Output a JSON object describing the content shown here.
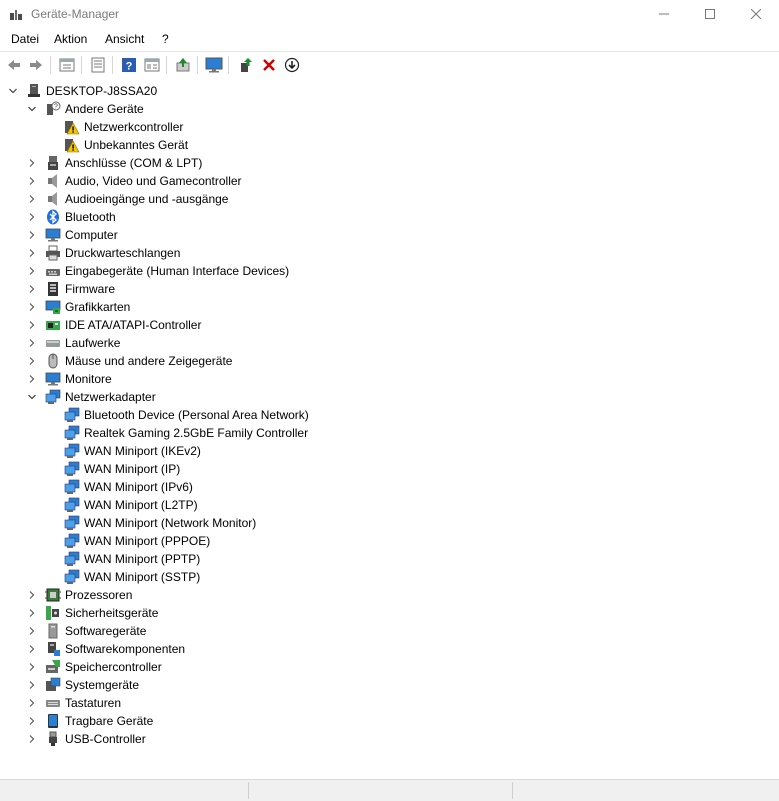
{
  "window": {
    "title": "Geräte-Manager"
  },
  "menu": [
    "Datei",
    "Aktion",
    "Ansicht",
    "?"
  ],
  "toolbar": {
    "colors": {
      "back": "#6e6e6e",
      "forward": "#6e6e6e",
      "help": "#2a5db0",
      "update": "#1a8a2a",
      "remove": "#d00000",
      "monitor": "#2b7fd3"
    },
    "buttons": [
      {
        "name": "back-button",
        "icon": "arrow-left-icon"
      },
      {
        "name": "forward-button",
        "icon": "arrow-right-icon"
      },
      {
        "name": "properties-button",
        "icon": "properties-icon"
      },
      {
        "name": "details-button",
        "icon": "details-icon"
      },
      {
        "name": "help-button",
        "icon": "help-icon"
      },
      {
        "name": "view-button",
        "icon": "view-icon"
      },
      {
        "name": "update-driver-button",
        "icon": "update-driver-icon"
      },
      {
        "name": "scan-hardware-button",
        "icon": "monitor-icon"
      },
      {
        "name": "enable-device-button",
        "icon": "enable-icon"
      },
      {
        "name": "uninstall-button",
        "icon": "red-x-icon"
      },
      {
        "name": "disable-button",
        "icon": "download-circle-icon"
      }
    ]
  },
  "tree": [
    {
      "label": "DESKTOP-J8SSA20",
      "level": 0,
      "expander": "expanded",
      "icon": "computer-root-icon"
    },
    {
      "label": "Andere Geräte",
      "level": 1,
      "expander": "expanded",
      "icon": "other-devices-icon"
    },
    {
      "label": "Netzwerkcontroller",
      "level": 2,
      "expander": "none",
      "icon": "warning-device-icon"
    },
    {
      "label": "Unbekanntes Gerät",
      "level": 2,
      "expander": "none",
      "icon": "warning-device-icon"
    },
    {
      "label": "Anschlüsse (COM & LPT)",
      "level": 1,
      "expander": "collapsed",
      "icon": "port-icon"
    },
    {
      "label": "Audio, Video und Gamecontroller",
      "level": 1,
      "expander": "collapsed",
      "icon": "speaker-icon"
    },
    {
      "label": "Audioeingänge und -ausgänge",
      "level": 1,
      "expander": "collapsed",
      "icon": "speaker-icon"
    },
    {
      "label": "Bluetooth",
      "level": 1,
      "expander": "collapsed",
      "icon": "bluetooth-icon"
    },
    {
      "label": "Computer",
      "level": 1,
      "expander": "collapsed",
      "icon": "monitor-icon"
    },
    {
      "label": "Druckwarteschlangen",
      "level": 1,
      "expander": "collapsed",
      "icon": "printer-icon"
    },
    {
      "label": "Eingabegeräte (Human Interface Devices)",
      "level": 1,
      "expander": "collapsed",
      "icon": "hid-icon"
    },
    {
      "label": "Firmware",
      "level": 1,
      "expander": "collapsed",
      "icon": "firmware-icon"
    },
    {
      "label": "Grafikkarten",
      "level": 1,
      "expander": "collapsed",
      "icon": "display-adapter-icon"
    },
    {
      "label": "IDE ATA/ATAPI-Controller",
      "level": 1,
      "expander": "collapsed",
      "icon": "ide-icon"
    },
    {
      "label": "Laufwerke",
      "level": 1,
      "expander": "collapsed",
      "icon": "drive-icon"
    },
    {
      "label": "Mäuse und andere Zeigegeräte",
      "level": 1,
      "expander": "collapsed",
      "icon": "mouse-icon"
    },
    {
      "label": "Monitore",
      "level": 1,
      "expander": "collapsed",
      "icon": "monitor-icon"
    },
    {
      "label": "Netzwerkadapter",
      "level": 1,
      "expander": "expanded",
      "icon": "network-icon"
    },
    {
      "label": "Bluetooth Device (Personal Area Network)",
      "level": 2,
      "expander": "none",
      "icon": "network-icon"
    },
    {
      "label": "Realtek Gaming 2.5GbE Family Controller",
      "level": 2,
      "expander": "none",
      "icon": "network-icon"
    },
    {
      "label": "WAN Miniport (IKEv2)",
      "level": 2,
      "expander": "none",
      "icon": "network-icon"
    },
    {
      "label": "WAN Miniport (IP)",
      "level": 2,
      "expander": "none",
      "icon": "network-icon"
    },
    {
      "label": "WAN Miniport (IPv6)",
      "level": 2,
      "expander": "none",
      "icon": "network-icon"
    },
    {
      "label": "WAN Miniport (L2TP)",
      "level": 2,
      "expander": "none",
      "icon": "network-icon"
    },
    {
      "label": "WAN Miniport (Network Monitor)",
      "level": 2,
      "expander": "none",
      "icon": "network-icon"
    },
    {
      "label": "WAN Miniport (PPPOE)",
      "level": 2,
      "expander": "none",
      "icon": "network-icon"
    },
    {
      "label": "WAN Miniport (PPTP)",
      "level": 2,
      "expander": "none",
      "icon": "network-icon"
    },
    {
      "label": "WAN Miniport (SSTP)",
      "level": 2,
      "expander": "none",
      "icon": "network-icon"
    },
    {
      "label": "Prozessoren",
      "level": 1,
      "expander": "collapsed",
      "icon": "processor-icon"
    },
    {
      "label": "Sicherheitsgeräte",
      "level": 1,
      "expander": "collapsed",
      "icon": "security-icon"
    },
    {
      "label": "Softwaregeräte",
      "level": 1,
      "expander": "collapsed",
      "icon": "software-device-icon"
    },
    {
      "label": "Softwarekomponenten",
      "level": 1,
      "expander": "collapsed",
      "icon": "software-component-icon"
    },
    {
      "label": "Speichercontroller",
      "level": 1,
      "expander": "collapsed",
      "icon": "storage-icon"
    },
    {
      "label": "Systemgeräte",
      "level": 1,
      "expander": "collapsed",
      "icon": "system-icon"
    },
    {
      "label": "Tastaturen",
      "level": 1,
      "expander": "collapsed",
      "icon": "keyboard-icon"
    },
    {
      "label": "Tragbare Geräte",
      "level": 1,
      "expander": "collapsed",
      "icon": "portable-icon"
    },
    {
      "label": "USB-Controller",
      "level": 1,
      "expander": "collapsed",
      "icon": "usb-icon"
    }
  ]
}
